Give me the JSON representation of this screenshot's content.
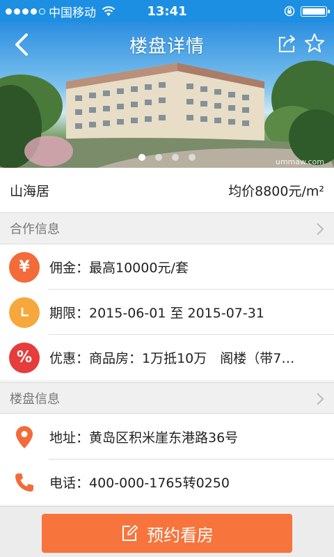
{
  "status_bar": {
    "carrier": "中国移动",
    "time": "13:41"
  },
  "nav": {
    "title": "楼盘详情",
    "icons": [
      "back-icon",
      "share-icon",
      "star-icon"
    ]
  },
  "carousel": {
    "slides": 4,
    "active_index": 0,
    "watermark": "ummaw.com"
  },
  "property": {
    "name": "山海居",
    "avg_price": "均价8800元/m²"
  },
  "cooperation": {
    "header": "合作信息",
    "items": [
      {
        "icon": "¥",
        "icon_name": "yuan-icon",
        "color": "#f36b3a",
        "text": "佣金：最高10000元/套"
      },
      {
        "icon": "",
        "icon_name": "clock-icon",
        "color": "#f6a83c",
        "text": "期限：2015-06-01 至 2015-07-31"
      },
      {
        "icon": "%",
        "icon_name": "percent-icon",
        "color": "#e63c3c",
        "text": "优惠：商品房：1万抵10万　阁楼（带7…"
      }
    ]
  },
  "building_info": {
    "header": "楼盘信息",
    "items": [
      {
        "icon_name": "location-pin-icon",
        "text": "地址：黄岛区积米崖东港路36号"
      },
      {
        "icon_name": "phone-icon",
        "text": "电话：400-000-1765转0250"
      }
    ]
  },
  "bottom": {
    "book_label": "预约看房"
  },
  "colors": {
    "accent": "#f7743c",
    "status_bar": "#1d8fe3"
  }
}
